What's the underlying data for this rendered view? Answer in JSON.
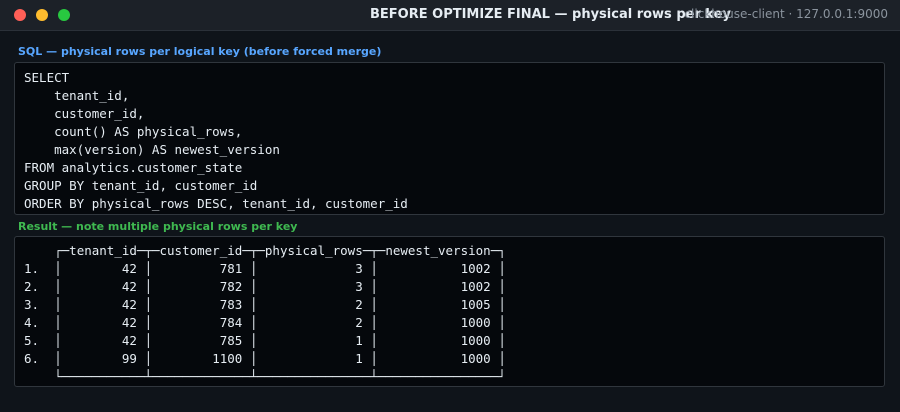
{
  "window": {
    "title": "BEFORE OPTIMIZE FINAL — physical rows per key",
    "connection": "clickhouse-client · 127.0.0.1:9000"
  },
  "sql": {
    "label": "SQL — physical rows per logical key (before forced merge)",
    "query": "SELECT\n    tenant_id,\n    customer_id,\n    count() AS physical_rows,\n    max(version) AS newest_version\nFROM analytics.customer_state\nGROUP BY tenant_id, customer_id\nORDER BY physical_rows DESC, tenant_id, customer_id"
  },
  "result": {
    "label": "Result — note multiple physical rows per key",
    "columns": [
      "tenant_id",
      "customer_id",
      "physical_rows",
      "newest_version"
    ],
    "rows": [
      [
        "42",
        "781",
        "3",
        "1002"
      ],
      [
        "42",
        "782",
        "3",
        "1002"
      ],
      [
        "42",
        "783",
        "2",
        "1005"
      ],
      [
        "42",
        "784",
        "2",
        "1000"
      ],
      [
        "42",
        "785",
        "1",
        "1000"
      ],
      [
        "99",
        "1100",
        "1",
        "1000"
      ]
    ]
  },
  "colors": {
    "sql_label": "#58a6ff",
    "result_label": "#3fb950",
    "background": "#05080c"
  }
}
